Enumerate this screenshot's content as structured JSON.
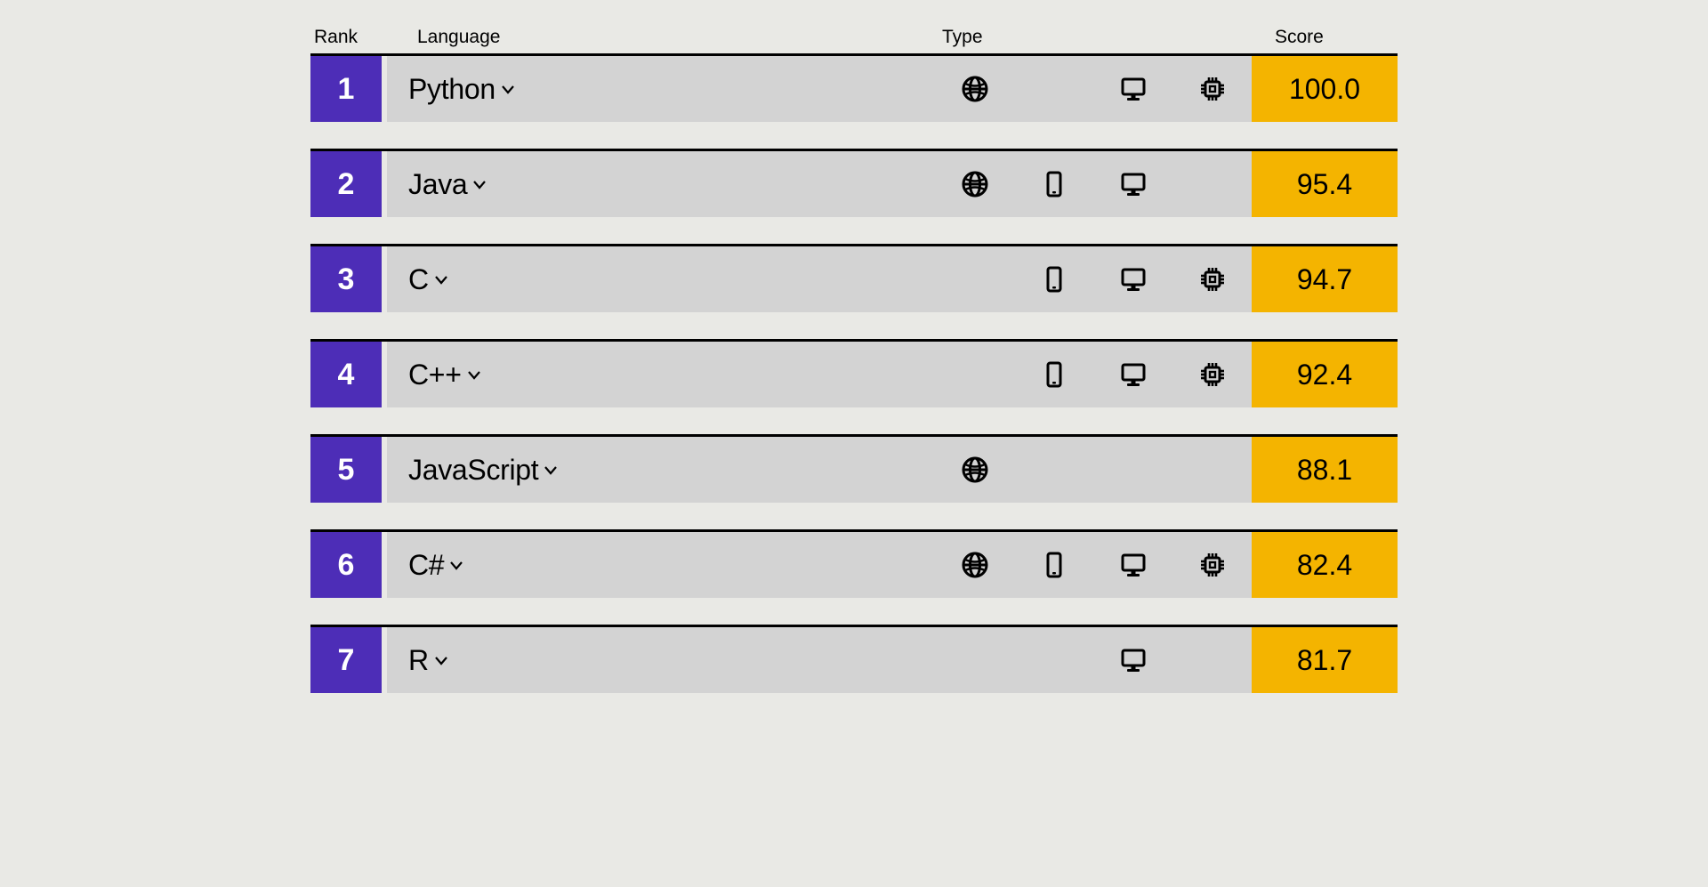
{
  "headers": {
    "rank": "Rank",
    "language": "Language",
    "type": "Type",
    "score": "Score"
  },
  "icon_types": [
    "web",
    "mobile",
    "desktop",
    "embedded"
  ],
  "rows": [
    {
      "rank": "1",
      "language": "Python",
      "types": [
        "web",
        "desktop",
        "embedded"
      ],
      "score": "100.0"
    },
    {
      "rank": "2",
      "language": "Java",
      "types": [
        "web",
        "mobile",
        "desktop"
      ],
      "score": "95.4"
    },
    {
      "rank": "3",
      "language": "C",
      "types": [
        "mobile",
        "desktop",
        "embedded"
      ],
      "score": "94.7"
    },
    {
      "rank": "4",
      "language": "C++",
      "types": [
        "mobile",
        "desktop",
        "embedded"
      ],
      "score": "92.4"
    },
    {
      "rank": "5",
      "language": "JavaScript",
      "types": [
        "web"
      ],
      "score": "88.1"
    },
    {
      "rank": "6",
      "language": "C#",
      "types": [
        "web",
        "mobile",
        "desktop",
        "embedded"
      ],
      "score": "82.4"
    },
    {
      "rank": "7",
      "language": "R",
      "types": [
        "desktop"
      ],
      "score": "81.7"
    }
  ],
  "chart_data": {
    "type": "table",
    "title": "",
    "columns": [
      "Rank",
      "Language",
      "Type",
      "Score"
    ],
    "categories": [
      "Python",
      "Java",
      "C",
      "C++",
      "JavaScript",
      "C#",
      "R"
    ],
    "values": [
      100.0,
      95.4,
      94.7,
      92.4,
      88.1,
      82.4,
      81.7
    ],
    "ranks": [
      1,
      2,
      3,
      4,
      5,
      6,
      7
    ],
    "types_per_row": [
      [
        "web",
        "desktop",
        "embedded"
      ],
      [
        "web",
        "mobile",
        "desktop"
      ],
      [
        "mobile",
        "desktop",
        "embedded"
      ],
      [
        "mobile",
        "desktop",
        "embedded"
      ],
      [
        "web"
      ],
      [
        "web",
        "mobile",
        "desktop",
        "embedded"
      ],
      [
        "desktop"
      ]
    ],
    "ylim": [
      0,
      100
    ]
  },
  "colors": {
    "rank_bg": "#4d2db7",
    "score_bg": "#f4b400",
    "row_bg": "#d3d3d3",
    "page_bg": "#e9e9e5"
  }
}
